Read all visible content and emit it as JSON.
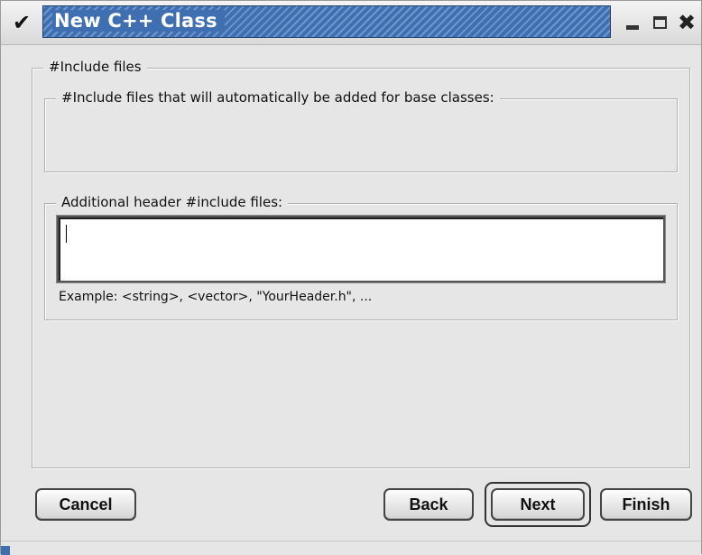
{
  "window": {
    "title": "New C++ Class",
    "menu_icon": "chevron-down-icon",
    "controls": {
      "minimize_icon": "minimize-icon",
      "maximize_icon": "maximize-icon",
      "close_icon": "close-icon",
      "close_glyph": "✖"
    },
    "title_color": "#3f6fb0"
  },
  "include_files": {
    "legend": "#Include files",
    "base_group": {
      "legend": "#Include files that will automatically be added for base classes:"
    },
    "additional_group": {
      "legend": "Additional header #include files:",
      "input_value": "",
      "example": "Example: <string>, <vector>, \"YourHeader.h\", ..."
    }
  },
  "buttons": {
    "cancel": "Cancel",
    "back": "Back",
    "next": "Next",
    "finish": "Finish"
  }
}
